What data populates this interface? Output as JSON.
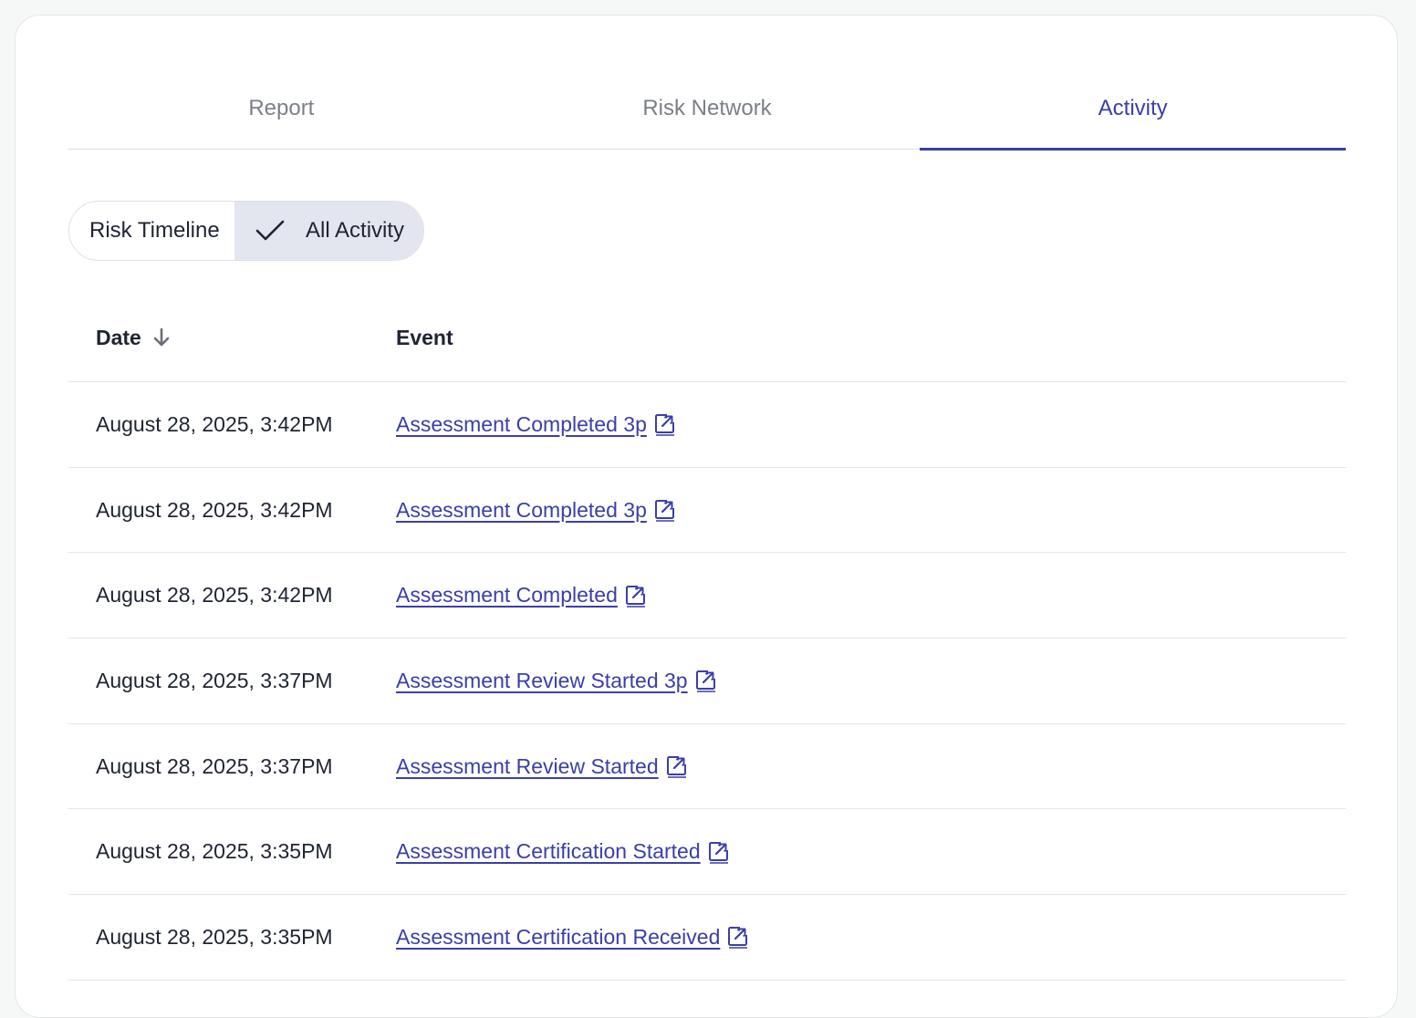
{
  "tabs": [
    {
      "label": "Report",
      "active": false
    },
    {
      "label": "Risk Network",
      "active": false
    },
    {
      "label": "Activity",
      "active": true
    }
  ],
  "toggle": {
    "options": [
      "Risk Timeline",
      "All Activity"
    ],
    "selected": "All Activity"
  },
  "table": {
    "headers": {
      "date": "Date",
      "event": "Event"
    },
    "sort": "date-descending",
    "rows": [
      {
        "date": "August 28, 2025, 3:42PM",
        "event": "Assessment Completed 3p"
      },
      {
        "date": "August 28, 2025, 3:42PM",
        "event": "Assessment Completed 3p"
      },
      {
        "date": "August 28, 2025, 3:42PM",
        "event": "Assessment Completed"
      },
      {
        "date": "August 28, 2025, 3:37PM",
        "event": "Assessment Review Started 3p"
      },
      {
        "date": "August 28, 2025, 3:37PM",
        "event": "Assessment Review Started"
      },
      {
        "date": "August 28, 2025, 3:35PM",
        "event": "Assessment Certification Started"
      },
      {
        "date": "August 28, 2025, 3:35PM",
        "event": "Assessment Certification Received"
      }
    ]
  },
  "icons": {
    "sort": "arrow-down-icon",
    "selected": "check-icon",
    "event_link": "external-link-icon"
  },
  "colors": {
    "accent": "#3a3fa8",
    "toggle_selected_bg": "#e3e6ee"
  }
}
